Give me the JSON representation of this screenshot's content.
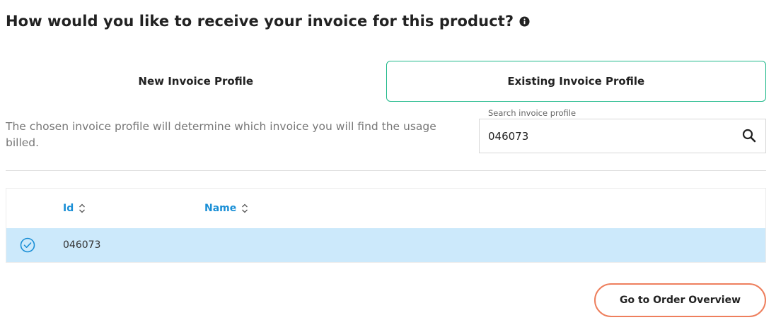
{
  "page": {
    "title": "How would you like to receive your invoice for this product?",
    "info_icon": "info-circle-icon"
  },
  "invoice_toggle": {
    "options": [
      {
        "label": "New Invoice Profile",
        "selected": false
      },
      {
        "label": "Existing Invoice Profile",
        "selected": true
      }
    ],
    "selected_border_color": "#1fb98a"
  },
  "description": "The chosen invoice profile will determine which invoice you will find the usage billed.",
  "search": {
    "label": "Search invoice profile",
    "value": "046073",
    "icon": "search-icon"
  },
  "table": {
    "columns": [
      {
        "label": "Id",
        "sort_icon": "sort-updown-icon"
      },
      {
        "label": "Name",
        "sort_icon": "sort-updown-icon"
      }
    ],
    "rows": [
      {
        "id": "046073",
        "name": "",
        "selected": true,
        "check_icon": "check-circle-icon"
      }
    ],
    "header_color": "#1a8fd6",
    "selected_row_color": "#cce9fb"
  },
  "actions": {
    "go_to_order_overview": "Go to Order Overview",
    "button_border_color": "#ee7f5d"
  }
}
